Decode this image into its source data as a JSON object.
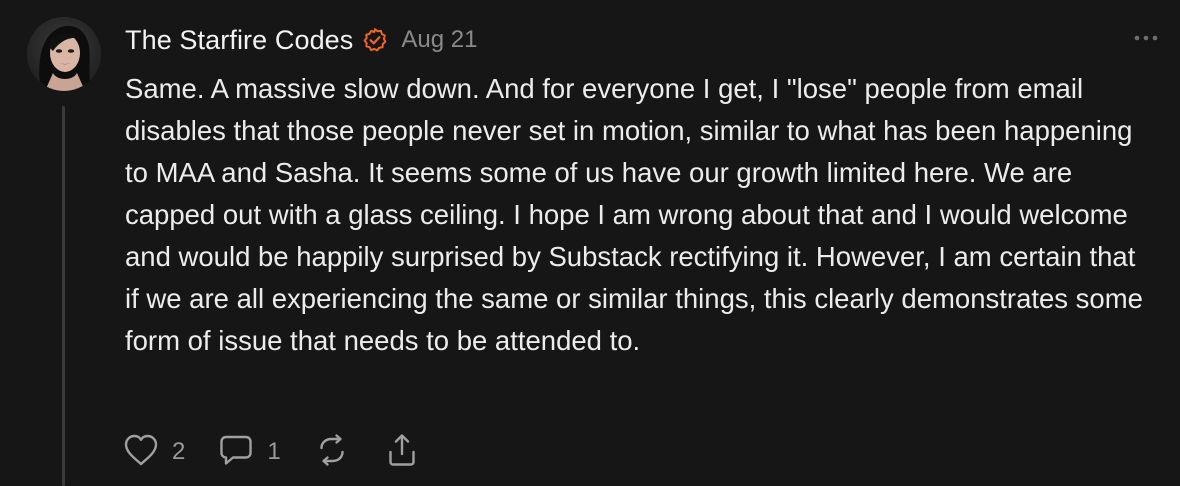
{
  "comment": {
    "author": "The Starfire Codes",
    "date": "Aug 21",
    "body": "Same. A massive slow down. And for everyone I get, I \"lose\" people from email disables that those people never set in motion, similar to what has been happening to MAA and Sasha. It seems some of us have our growth limited here. We are capped out with a glass ceiling. I hope I am wrong about that and I would welcome and would be happily surprised by Substack rectifying it. However, I am certain that if we are all experiencing the same or similar things, this clearly demonstrates some form of issue that needs to be attended to.",
    "actions": {
      "like_count": "2",
      "reply_count": "1"
    }
  },
  "colors": {
    "background": "#161616",
    "text": "#ececec",
    "muted": "#8a8a8a",
    "verified_badge": "#f26522",
    "thread_line": "#3a3a3a"
  },
  "icons": {
    "verified": "verified-badge-icon",
    "more": "more-dots-icon",
    "like": "heart-icon",
    "reply": "speech-bubble-icon",
    "restack": "restack-icon",
    "share": "share-icon"
  }
}
